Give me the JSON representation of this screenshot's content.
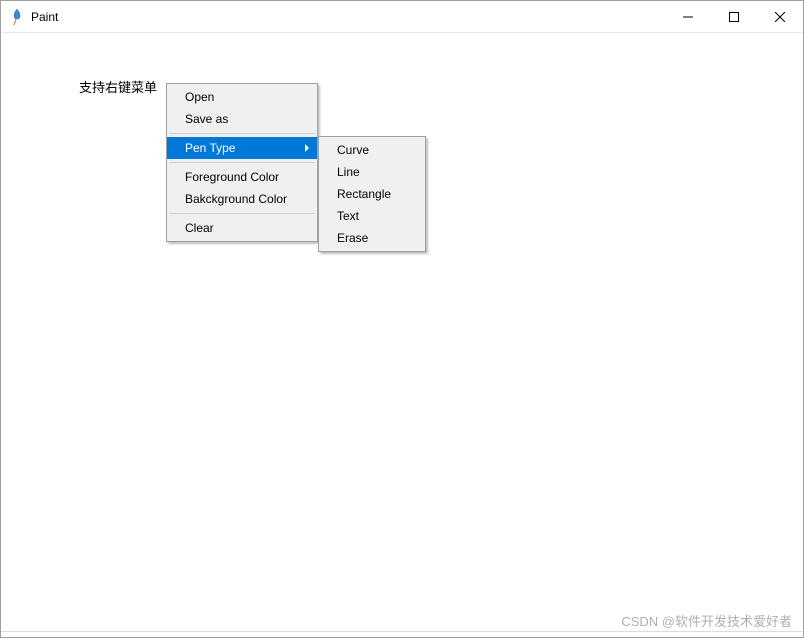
{
  "window": {
    "title": "Paint"
  },
  "canvas": {
    "label": "支持右键菜单"
  },
  "context_menu": {
    "items": [
      {
        "label": "Open"
      },
      {
        "label": "Save as"
      },
      {
        "label": "Pen Type",
        "has_submenu": true,
        "highlighted": true
      },
      {
        "label": "Foreground Color"
      },
      {
        "label": "Bakckground Color"
      },
      {
        "label": "Clear"
      }
    ]
  },
  "submenu": {
    "items": [
      {
        "label": "Curve"
      },
      {
        "label": "Line"
      },
      {
        "label": "Rectangle"
      },
      {
        "label": "Text"
      },
      {
        "label": "Erase"
      }
    ]
  },
  "watermark": "CSDN @软件开发技术爱好者"
}
